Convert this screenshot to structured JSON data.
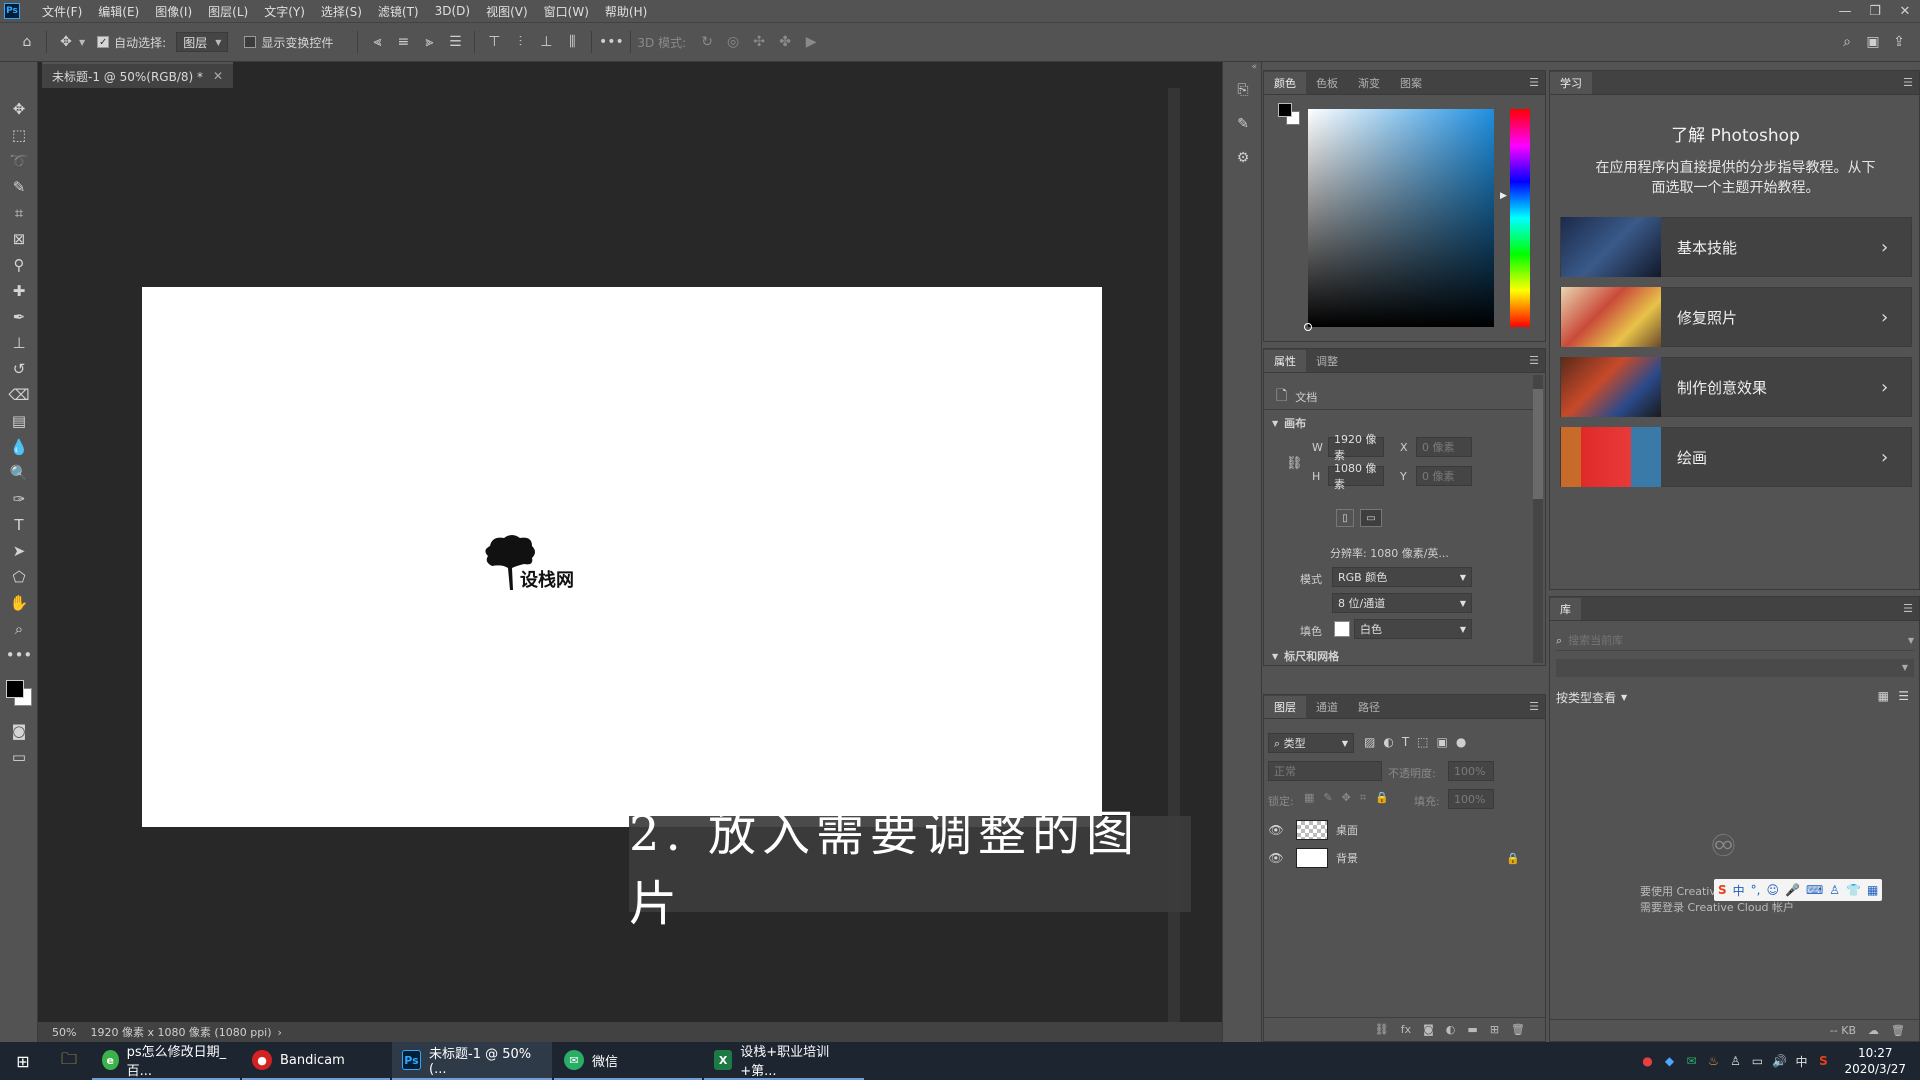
{
  "app": {
    "logo": "Ps",
    "menu": [
      "文件(F)",
      "编辑(E)",
      "图像(I)",
      "图层(L)",
      "文字(Y)",
      "选择(S)",
      "滤镜(T)",
      "3D(D)",
      "视图(V)",
      "窗口(W)",
      "帮助(H)"
    ]
  },
  "options_bar": {
    "auto_select_label": "自动选择:",
    "auto_select_target": "图层",
    "show_transform_label": "显示变换控件",
    "mode_3d_label": "3D 模式:"
  },
  "document": {
    "tab_title": "未标题-1 @ 50%(RGB/8) *",
    "logo_text": "设栈网",
    "status_zoom": "50%",
    "status_info": "1920 像素 x 1080 像素 (1080 ppi)"
  },
  "subtitle": "2. 放入需要调整的图片",
  "color_panel": {
    "tabs": [
      "颜色",
      "色板",
      "渐变",
      "图案"
    ],
    "foreground": "#000000",
    "background": "#ffffff",
    "picker_hue_color": "#1e8fe0"
  },
  "properties_panel": {
    "tabs": [
      "属性",
      "调整"
    ],
    "doc_label": "文档",
    "canvas_section": "画布",
    "w_label": "W",
    "w_value": "1920 像素",
    "h_label": "H",
    "h_value": "1080 像素",
    "x_label": "X",
    "x_value": "0 像素",
    "y_label": "Y",
    "y_value": "0 像素",
    "resolution": "分辨率: 1080 像素/英...",
    "mode_label": "模式",
    "mode_value": "RGB 颜色",
    "depth_value": "8 位/通道",
    "fill_label": "填色",
    "fill_value": "白色",
    "next_section": "标尺和网格"
  },
  "layers_panel": {
    "tabs": [
      "图层",
      "通道",
      "路径"
    ],
    "filter_kind": "类型",
    "blend_mode": "正常",
    "opacity_label": "不透明度:",
    "opacity_value": "100%",
    "lock_label": "锁定:",
    "fill_label": "填充:",
    "fill_value": "100%",
    "layers": [
      {
        "name": "桌面",
        "locked": false
      },
      {
        "name": "背景",
        "locked": true
      }
    ]
  },
  "learn_panel": {
    "tab": "学习",
    "heading": "了解 Photoshop",
    "description_line1": "在应用程序内直接提供的分步指导教程。从下",
    "description_line2": "面选取一个主题开始教程。",
    "cards": [
      {
        "title": "基本技能"
      },
      {
        "title": "修复照片"
      },
      {
        "title": "制作创意效果"
      },
      {
        "title": "绘画"
      }
    ]
  },
  "library_panel": {
    "tab": "库",
    "search_placeholder": "搜索当前库",
    "view_by": "按类型查看",
    "cc_message_line1": "要使用 Creative Cloud 库,",
    "cc_message_line2": "需要登录 Creative Cloud 帐户",
    "kb_label": "-- KB"
  },
  "taskbar": {
    "apps": [
      {
        "label": "ps怎么修改日期_百...",
        "color": "#3cb34a",
        "icon": "e"
      },
      {
        "label": "Bandicam",
        "color": "#d42222",
        "icon": "●"
      },
      {
        "label": "未标题-1 @ 50%(...",
        "color": "#001e36",
        "icon": "Ps"
      },
      {
        "label": "微信",
        "color": "#2aae67",
        "icon": "✉"
      },
      {
        "label": "设栈+职业培训+第...",
        "color": "#1d7a44",
        "icon": "X"
      }
    ],
    "ime": "中",
    "time": "10:27",
    "date": "2020/3/27"
  }
}
